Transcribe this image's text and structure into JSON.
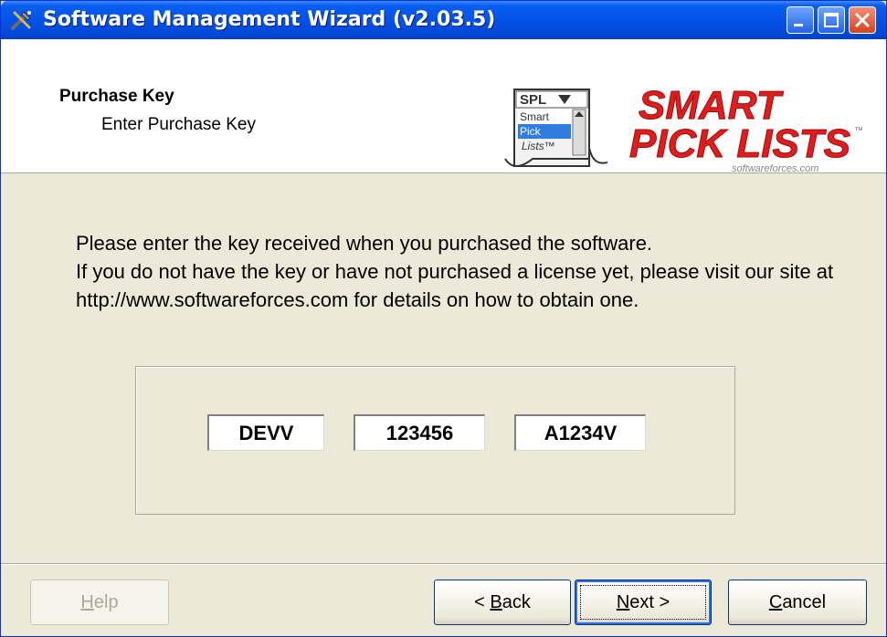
{
  "window": {
    "title": "Software Management Wizard (v2.03.5)"
  },
  "header": {
    "title": "Purchase Key",
    "subtitle": "Enter Purchase Key",
    "logo": {
      "badge_text": "SPL",
      "list_items": [
        "Smart",
        "Pick",
        "Lists™"
      ],
      "brand_line1": "SMART",
      "brand_line2": "PICK LISTS",
      "tm": "™",
      "url": "softwareforces.com"
    }
  },
  "instructions": {
    "line1": "Please enter the key received when you purchased the software.",
    "line2": "If you do not have the key or have not purchased a license yet, please visit our site at http://www.softwareforces.com for details on how to obtain one."
  },
  "key": {
    "part1": "DEVV",
    "part2": "123456",
    "part3": "A1234V"
  },
  "buttons": {
    "help": {
      "accel": "H",
      "rest": "elp"
    },
    "back": {
      "prefix": "< ",
      "accel": "B",
      "rest": "ack"
    },
    "next": {
      "accel": "N",
      "rest": "ext >"
    },
    "cancel": {
      "accel": "C",
      "rest": "ancel"
    }
  },
  "colors": {
    "titlebar": "#0553e6",
    "face": "#ece9d8",
    "brand_red": "#e21b1b"
  }
}
